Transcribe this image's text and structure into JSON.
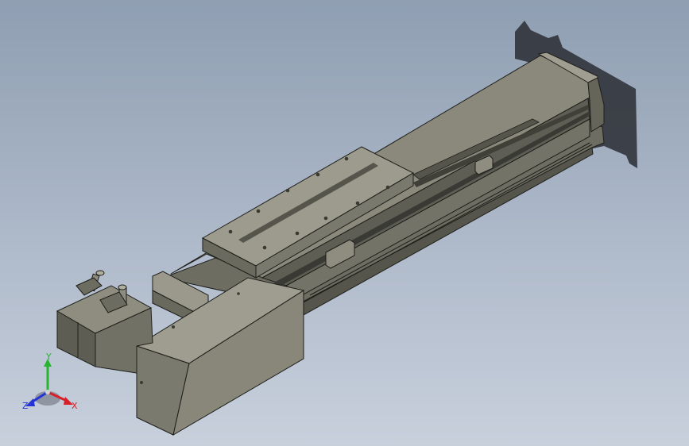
{
  "viewport": {
    "background_top": "#8f9eb2",
    "background_bottom": "#c8d0dc"
  },
  "model": {
    "part_color": "#7d7c70",
    "shade_light": "#a4a396",
    "shade_dark": "#55554c",
    "edge_color": "#1e1e1a",
    "shadow_color": "#2a2d33"
  },
  "triad": {
    "y_label": "Y",
    "x_label": "X",
    "z_label": "Z",
    "x_color": "#d8202a",
    "y_color": "#27b52f",
    "z_color": "#2634d6"
  }
}
